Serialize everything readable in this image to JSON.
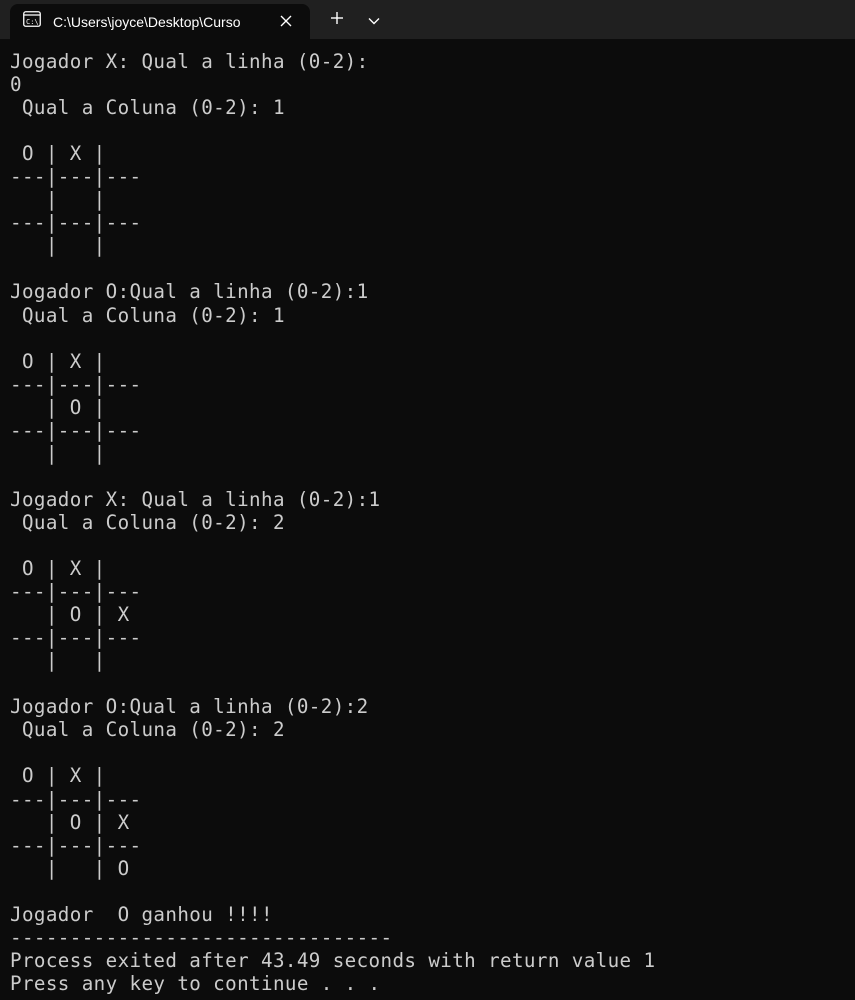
{
  "window": {
    "tab_title": "C:\\Users\\joyce\\Desktop\\Curso",
    "tab_icon": "terminal-icon",
    "close_icon": "close-icon",
    "new_tab_icon": "plus-icon",
    "dropdown_icon": "chevron-down-icon"
  },
  "colors": {
    "background": "#0c0c0c",
    "titlebar": "#202020",
    "text": "#cccccc"
  },
  "console": {
    "lines": [
      "Jogador X: Qual a linha (0-2):",
      "0",
      " Qual a Coluna (0-2): 1",
      "",
      " O | X |",
      "---|---|---",
      "   |   |",
      "---|---|---",
      "   |   |",
      "",
      "Jogador O:Qual a linha (0-2):1",
      " Qual a Coluna (0-2): 1",
      "",
      " O | X |",
      "---|---|---",
      "   | O |",
      "---|---|---",
      "   |   |",
      "",
      "Jogador X: Qual a linha (0-2):1",
      " Qual a Coluna (0-2): 2",
      "",
      " O | X |",
      "---|---|---",
      "   | O | X",
      "---|---|---",
      "   |   |",
      "",
      "Jogador O:Qual a linha (0-2):2",
      " Qual a Coluna (0-2): 2",
      "",
      " O | X |",
      "---|---|---",
      "   | O | X",
      "---|---|---",
      "   |   | O",
      "",
      "Jogador  O ganhou !!!!",
      "--------------------------------",
      "Process exited after 43.49 seconds with return value 1",
      "Press any key to continue . . ."
    ]
  }
}
